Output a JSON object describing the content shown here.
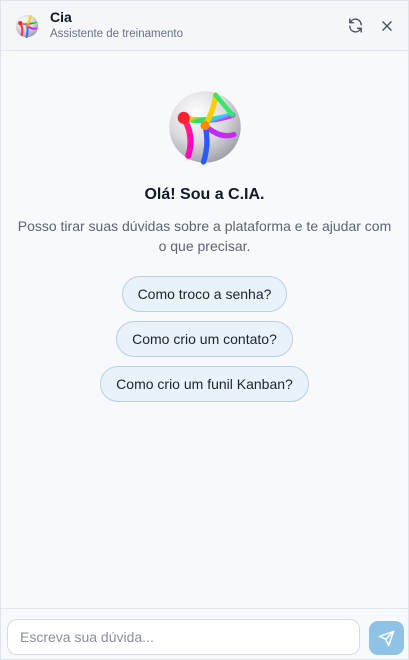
{
  "header": {
    "title": "Cia",
    "subtitle": "Assistente de treinamento",
    "avatar_icon": "cia-logo-icon",
    "refresh_icon": "refresh-icon",
    "close_icon": "close-icon"
  },
  "welcome": {
    "avatar_icon": "cia-logo-icon",
    "title": "Olá! Sou a C.IA.",
    "text": "Posso tirar suas dúvidas sobre a plataforma e te ajudar com o que precisar."
  },
  "suggestions": [
    {
      "label": "Como troco a senha?"
    },
    {
      "label": "Como crio um contato?"
    },
    {
      "label": "Como crio um funil Kanban?"
    }
  ],
  "composer": {
    "placeholder": "Escreva sua dúvida...",
    "value": "",
    "send_icon": "send-icon"
  },
  "colors": {
    "accent": "#8ec3e6",
    "chip_border": "#b6d0e6",
    "chip_background": "#eaf2f9"
  }
}
